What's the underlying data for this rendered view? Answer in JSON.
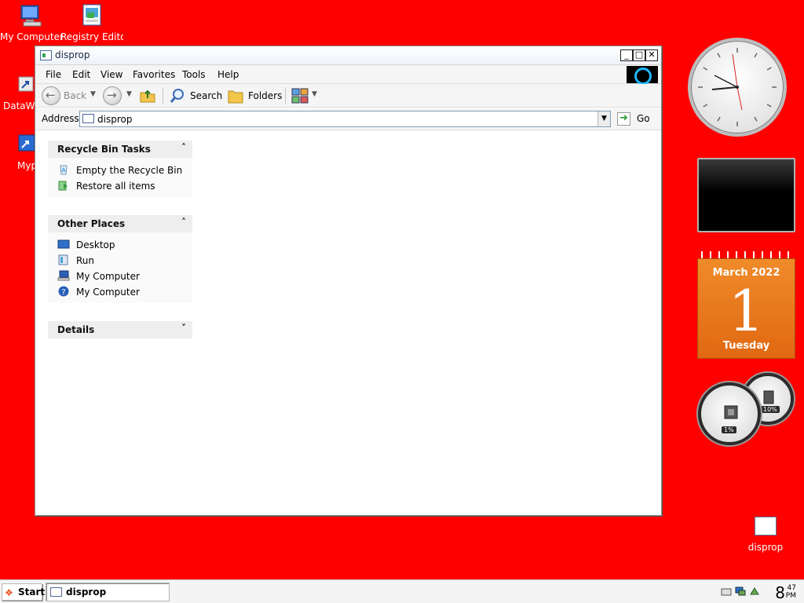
{
  "desktop": {
    "background_color": "#ff0000",
    "icons": [
      {
        "label": "My Computer",
        "icon": "my-computer-icon"
      },
      {
        "label": "Registry Editor",
        "icon": "registry-editor-icon"
      },
      {
        "label": "DataWa",
        "icon": "datawa-shortcut-icon"
      },
      {
        "label": "Myp",
        "icon": "myp-shortcut-icon"
      },
      {
        "label": "disprop",
        "icon": "disprop-icon"
      }
    ]
  },
  "window": {
    "title": "disprop",
    "menu": [
      "File",
      "Edit",
      "View",
      "Favorites",
      "Tools",
      "Help"
    ],
    "toolbar": {
      "back_label": "Back",
      "search_label": "Search",
      "folders_label": "Folders"
    },
    "address": {
      "label": "Address",
      "value": "disprop",
      "go_label": "Go"
    },
    "task_panes": [
      {
        "title": "Recycle Bin Tasks",
        "chevron": "˄",
        "items": [
          {
            "label": "Empty the Recycle Bin",
            "icon": "recycle-bin-icon"
          },
          {
            "label": "Restore all items",
            "icon": "restore-icon"
          }
        ]
      },
      {
        "title": "Other Places",
        "chevron": "˄",
        "items": [
          {
            "label": "Desktop",
            "icon": "desktop-icon"
          },
          {
            "label": "Run",
            "icon": "run-icon"
          },
          {
            "label": "My Computer",
            "icon": "my-computer-icon"
          },
          {
            "label": "My Computer",
            "icon": "help-icon"
          }
        ]
      },
      {
        "title": "Details",
        "chevron": "˅"
      }
    ]
  },
  "gadgets": {
    "calendar": {
      "month": "March 2022",
      "day": "1",
      "weekday": "Tuesday"
    },
    "gauges": {
      "cpu_percent": "1%",
      "memory_percent": "10%"
    }
  },
  "taskbar": {
    "start_label": "Start",
    "task_label": "disprop",
    "clock": {
      "hour": "8",
      "minute": "47",
      "ampm": "PM"
    }
  }
}
